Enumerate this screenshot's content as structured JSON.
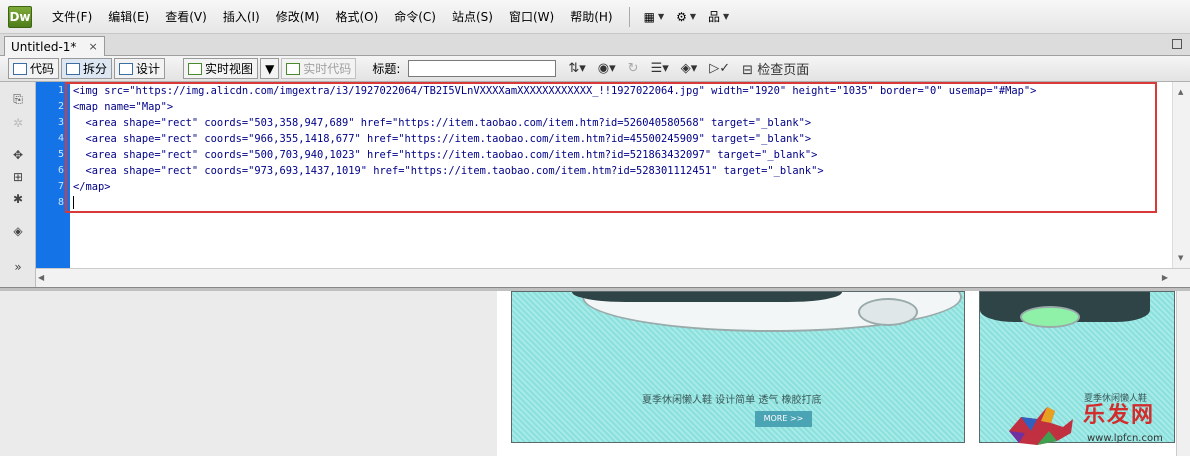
{
  "app": {
    "logo": "Dw",
    "menu": [
      "文件(F)",
      "编辑(E)",
      "查看(V)",
      "插入(I)",
      "修改(M)",
      "格式(O)",
      "命令(C)",
      "站点(S)",
      "窗口(W)",
      "帮助(H)"
    ],
    "menu_tools": [
      "layout-icon",
      "gear-icon",
      "site-icon"
    ]
  },
  "document": {
    "tab_title": "Untitled-1*",
    "tab_close": "×"
  },
  "toolbar": {
    "code_label": "代码",
    "split_label": "拆分",
    "design_label": "设计",
    "live_view_label": "实时视图",
    "live_code_label": "实时代码",
    "title_label": "标题:",
    "title_value": "",
    "inspect_label": "检查页面"
  },
  "editor": {
    "line_numbers": [
      "1",
      "2",
      "3",
      "4",
      "5",
      "6",
      "7",
      "8"
    ],
    "lines": [
      "<img src=\"https://img.alicdn.com/imgextra/i3/1927022064/TB2I5VLnVXXXXamXXXXXXXXXXXX_!!1927022064.jpg\" width=\"1920\" height=\"1035\" border=\"0\" usemap=\"#Map\">",
      "<map name=\"Map\">",
      "  <area shape=\"rect\" coords=\"503,358,947,689\" href=\"https://item.taobao.com/item.htm?id=526040580568\" target=\"_blank\">",
      "  <area shape=\"rect\" coords=\"966,355,1418,677\" href=\"https://item.taobao.com/item.htm?id=45500245909\" target=\"_blank\">",
      "  <area shape=\"rect\" coords=\"500,703,940,1023\" href=\"https://item.taobao.com/item.htm?id=521863432097\" target=\"_blank\">",
      "  <area shape=\"rect\" coords=\"973,693,1437,1019\" href=\"https://item.taobao.com/item.htm?id=528301112451\" target=\"_blank\">",
      "</map>",
      ""
    ]
  },
  "design_view": {
    "caption_1": "夏季休闲懒人鞋    设计简单 透气 橡胶打底",
    "more_button": "MORE >>",
    "caption_2": "夏季休闲懒人鞋"
  },
  "watermark": {
    "brand": "乐发网",
    "url": "www.lpfcn.com"
  },
  "colors": {
    "gutter": "#1473e6",
    "highlight_box": "#d83a3a",
    "dw_logo": "#5f8f24"
  }
}
